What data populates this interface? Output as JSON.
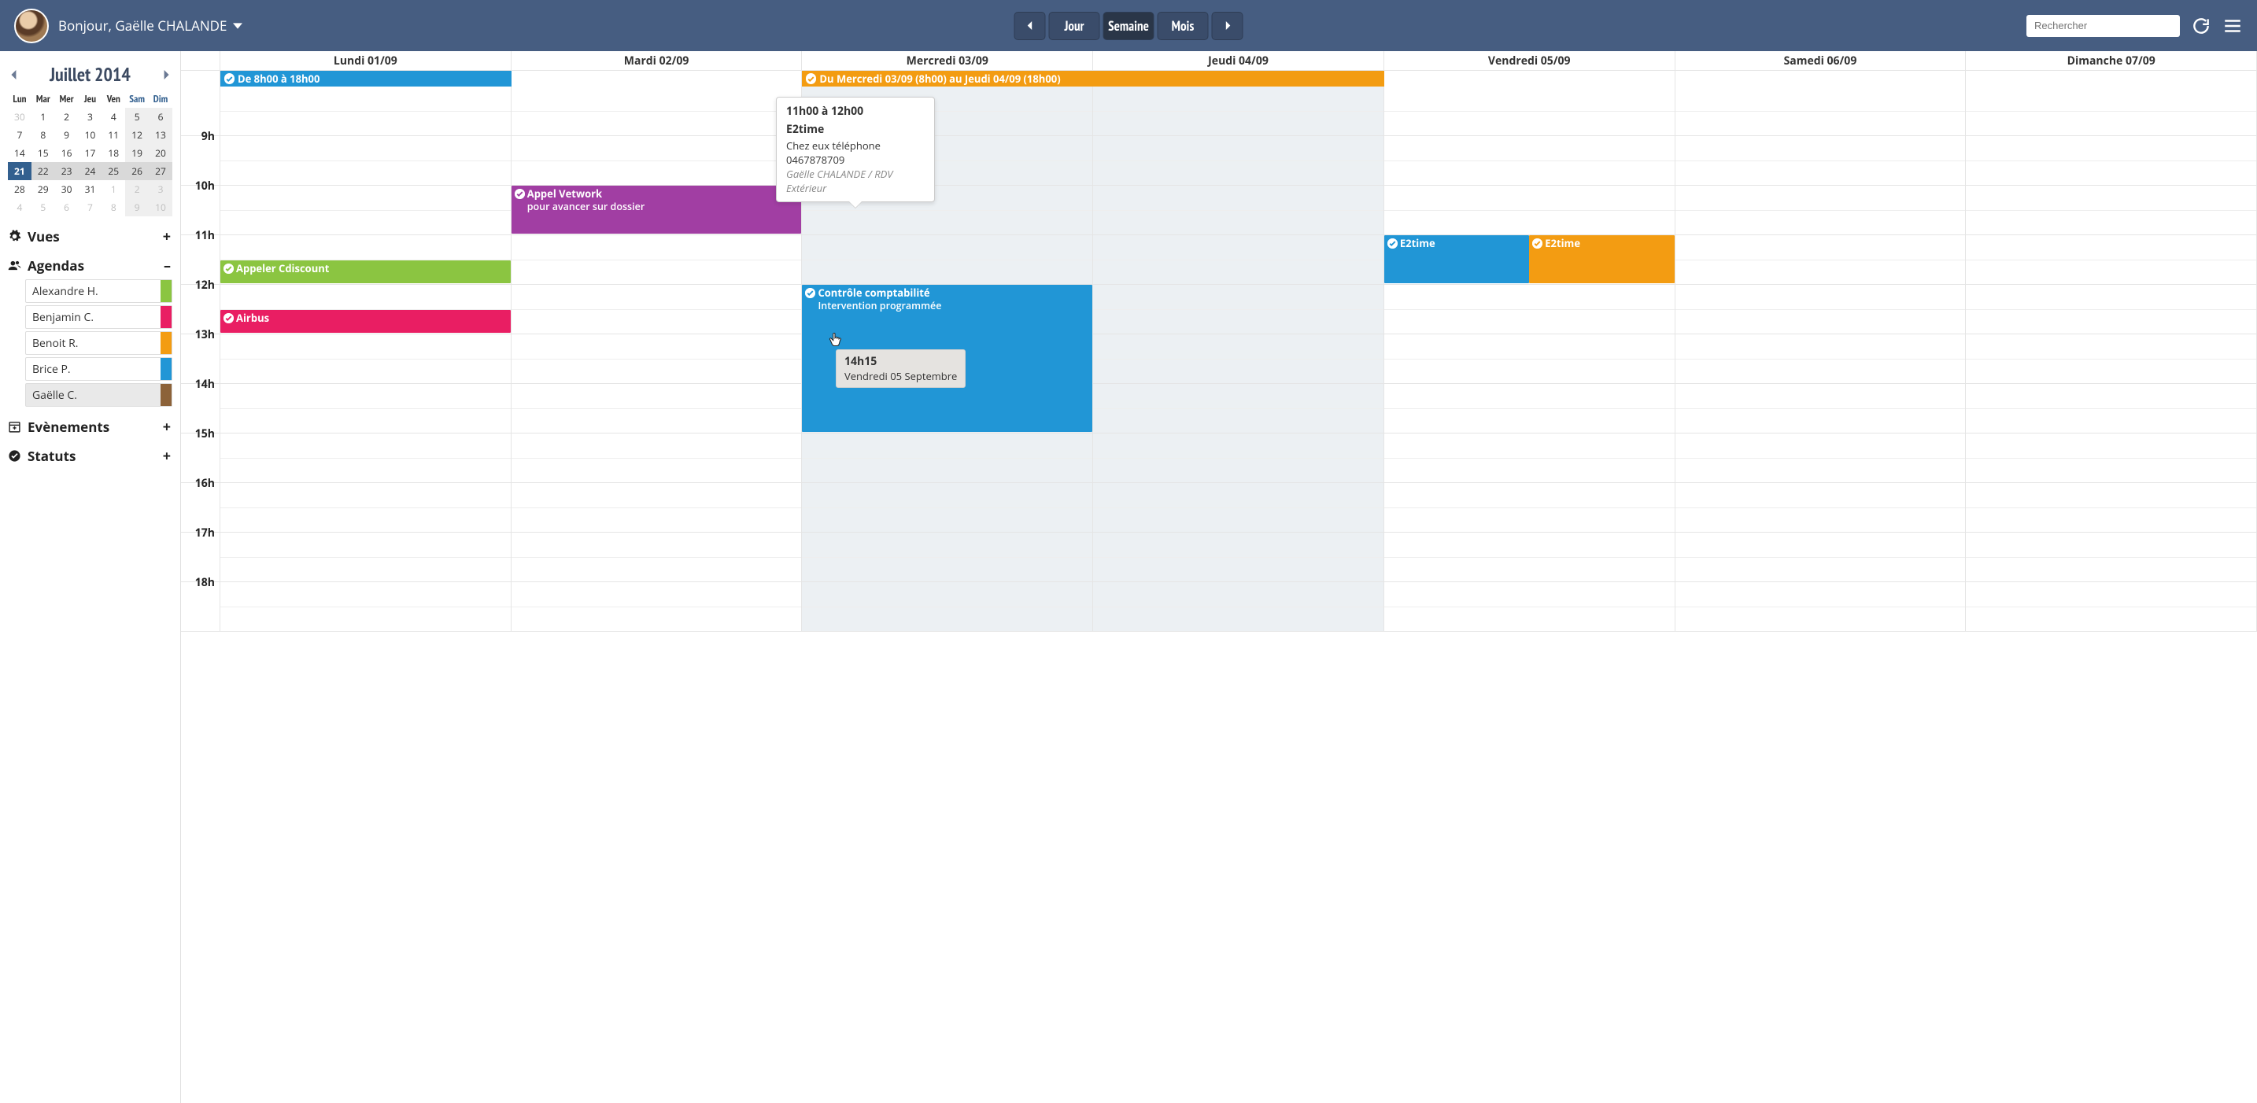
{
  "header": {
    "greeting": "Bonjour, Gaëlle CHALANDE",
    "views": {
      "day": "Jour",
      "week": "Semaine",
      "month": "Mois",
      "active": "week"
    },
    "search_placeholder": "Rechercher"
  },
  "minical": {
    "title": "Juillet 2014",
    "dow": [
      "Lun",
      "Mar",
      "Mer",
      "Jeu",
      "Ven",
      "Sam",
      "Dim"
    ],
    "rows": [
      [
        {
          "d": "30",
          "o": true
        },
        {
          "d": "1"
        },
        {
          "d": "2"
        },
        {
          "d": "3"
        },
        {
          "d": "4"
        },
        {
          "d": "5",
          "wk": true
        },
        {
          "d": "6",
          "wk": true
        }
      ],
      [
        {
          "d": "7"
        },
        {
          "d": "8"
        },
        {
          "d": "9"
        },
        {
          "d": "10"
        },
        {
          "d": "11"
        },
        {
          "d": "12",
          "wk": true
        },
        {
          "d": "13",
          "wk": true
        }
      ],
      [
        {
          "d": "14"
        },
        {
          "d": "15"
        },
        {
          "d": "16"
        },
        {
          "d": "17"
        },
        {
          "d": "18"
        },
        {
          "d": "19",
          "wk": true
        },
        {
          "d": "20",
          "wk": true
        }
      ],
      [
        {
          "d": "21",
          "sel": true,
          "cw": true
        },
        {
          "d": "22",
          "cw": true
        },
        {
          "d": "23",
          "cw": true
        },
        {
          "d": "24",
          "cw": true
        },
        {
          "d": "25",
          "cw": true
        },
        {
          "d": "26",
          "wk": true,
          "cw": true
        },
        {
          "d": "27",
          "wk": true,
          "cw": true
        }
      ],
      [
        {
          "d": "28"
        },
        {
          "d": "29"
        },
        {
          "d": "30"
        },
        {
          "d": "31"
        },
        {
          "d": "1",
          "o": true
        },
        {
          "d": "2",
          "o": true,
          "wk": true
        },
        {
          "d": "3",
          "o": true,
          "wk": true
        }
      ],
      [
        {
          "d": "4",
          "o": true
        },
        {
          "d": "5",
          "o": true
        },
        {
          "d": "6",
          "o": true
        },
        {
          "d": "7",
          "o": true
        },
        {
          "d": "8",
          "o": true
        },
        {
          "d": "9",
          "o": true,
          "wk": true
        },
        {
          "d": "10",
          "o": true,
          "wk": true
        }
      ]
    ]
  },
  "sections": {
    "vues": {
      "label": "Vues",
      "toggle": "+"
    },
    "agendas": {
      "label": "Agendas",
      "toggle": "–",
      "items": [
        {
          "name": "Alexandre H.",
          "color": "#8bc541"
        },
        {
          "name": "Benjamin C.",
          "color": "#e91e63"
        },
        {
          "name": "Benoit R.",
          "color": "#f39c12"
        },
        {
          "name": "Brice P.",
          "color": "#2196d6"
        },
        {
          "name": "Gaëlle C.",
          "color": "#8c6239",
          "selected": true
        }
      ]
    },
    "evenements": {
      "label": "Evènements",
      "toggle": "+"
    },
    "statuts": {
      "label": "Statuts",
      "toggle": "+"
    }
  },
  "week": {
    "days": [
      "Lundi 01/09",
      "Mardi 02/09",
      "Mercredi 03/09",
      "Jeudi 04/09",
      "Vendredi 05/09",
      "Samedi 06/09",
      "Dimanche 07/09"
    ],
    "hours": [
      "9h",
      "10h",
      "11h",
      "12h",
      "13h",
      "14h",
      "15h",
      "16h",
      "17h",
      "18h"
    ]
  },
  "allday": [
    {
      "day": 0,
      "span": 1,
      "text": "De 8h00 à 18h00",
      "color": "#2196d6"
    },
    {
      "day": 2,
      "span": 2,
      "text": "Du Mercredi 03/09 (8h00) au Jeudi 04/09 (18h00)",
      "color": "#f39c12"
    }
  ],
  "events": [
    {
      "day": 1,
      "start": 10,
      "end": 11,
      "title": "Appel Vetwork",
      "sub": "pour avancer sur dossier",
      "color": "#a13ea3"
    },
    {
      "day": 0,
      "start": 11.5,
      "end": 12,
      "title": "Appeler Cdiscount",
      "color": "#8bc541"
    },
    {
      "day": 0,
      "start": 12.5,
      "end": 13,
      "title": "Airbus",
      "color": "#e91e63"
    },
    {
      "day": 2,
      "start": 12,
      "end": 15,
      "title": "Contrôle comptabilité",
      "sub": "Intervention programmée",
      "color": "#2196d6"
    },
    {
      "day": 4,
      "start": 11,
      "end": 12,
      "title": "E2time",
      "color": "#2196d6",
      "width": 0.5,
      "left": 0
    },
    {
      "day": 4,
      "start": 11,
      "end": 12,
      "title": "E2time",
      "color": "#f39c12",
      "width": 0.5,
      "left": 0.5
    }
  ],
  "tooltip": {
    "time": "11h00 à 12h00",
    "title": "E2time",
    "desc": "Chez eux téléphone 0467878709",
    "meta": "Gaëlle CHALANDE / RDV Extérieur"
  },
  "draghint": {
    "time": "14h15",
    "date": "Vendredi 05 Septembre"
  }
}
